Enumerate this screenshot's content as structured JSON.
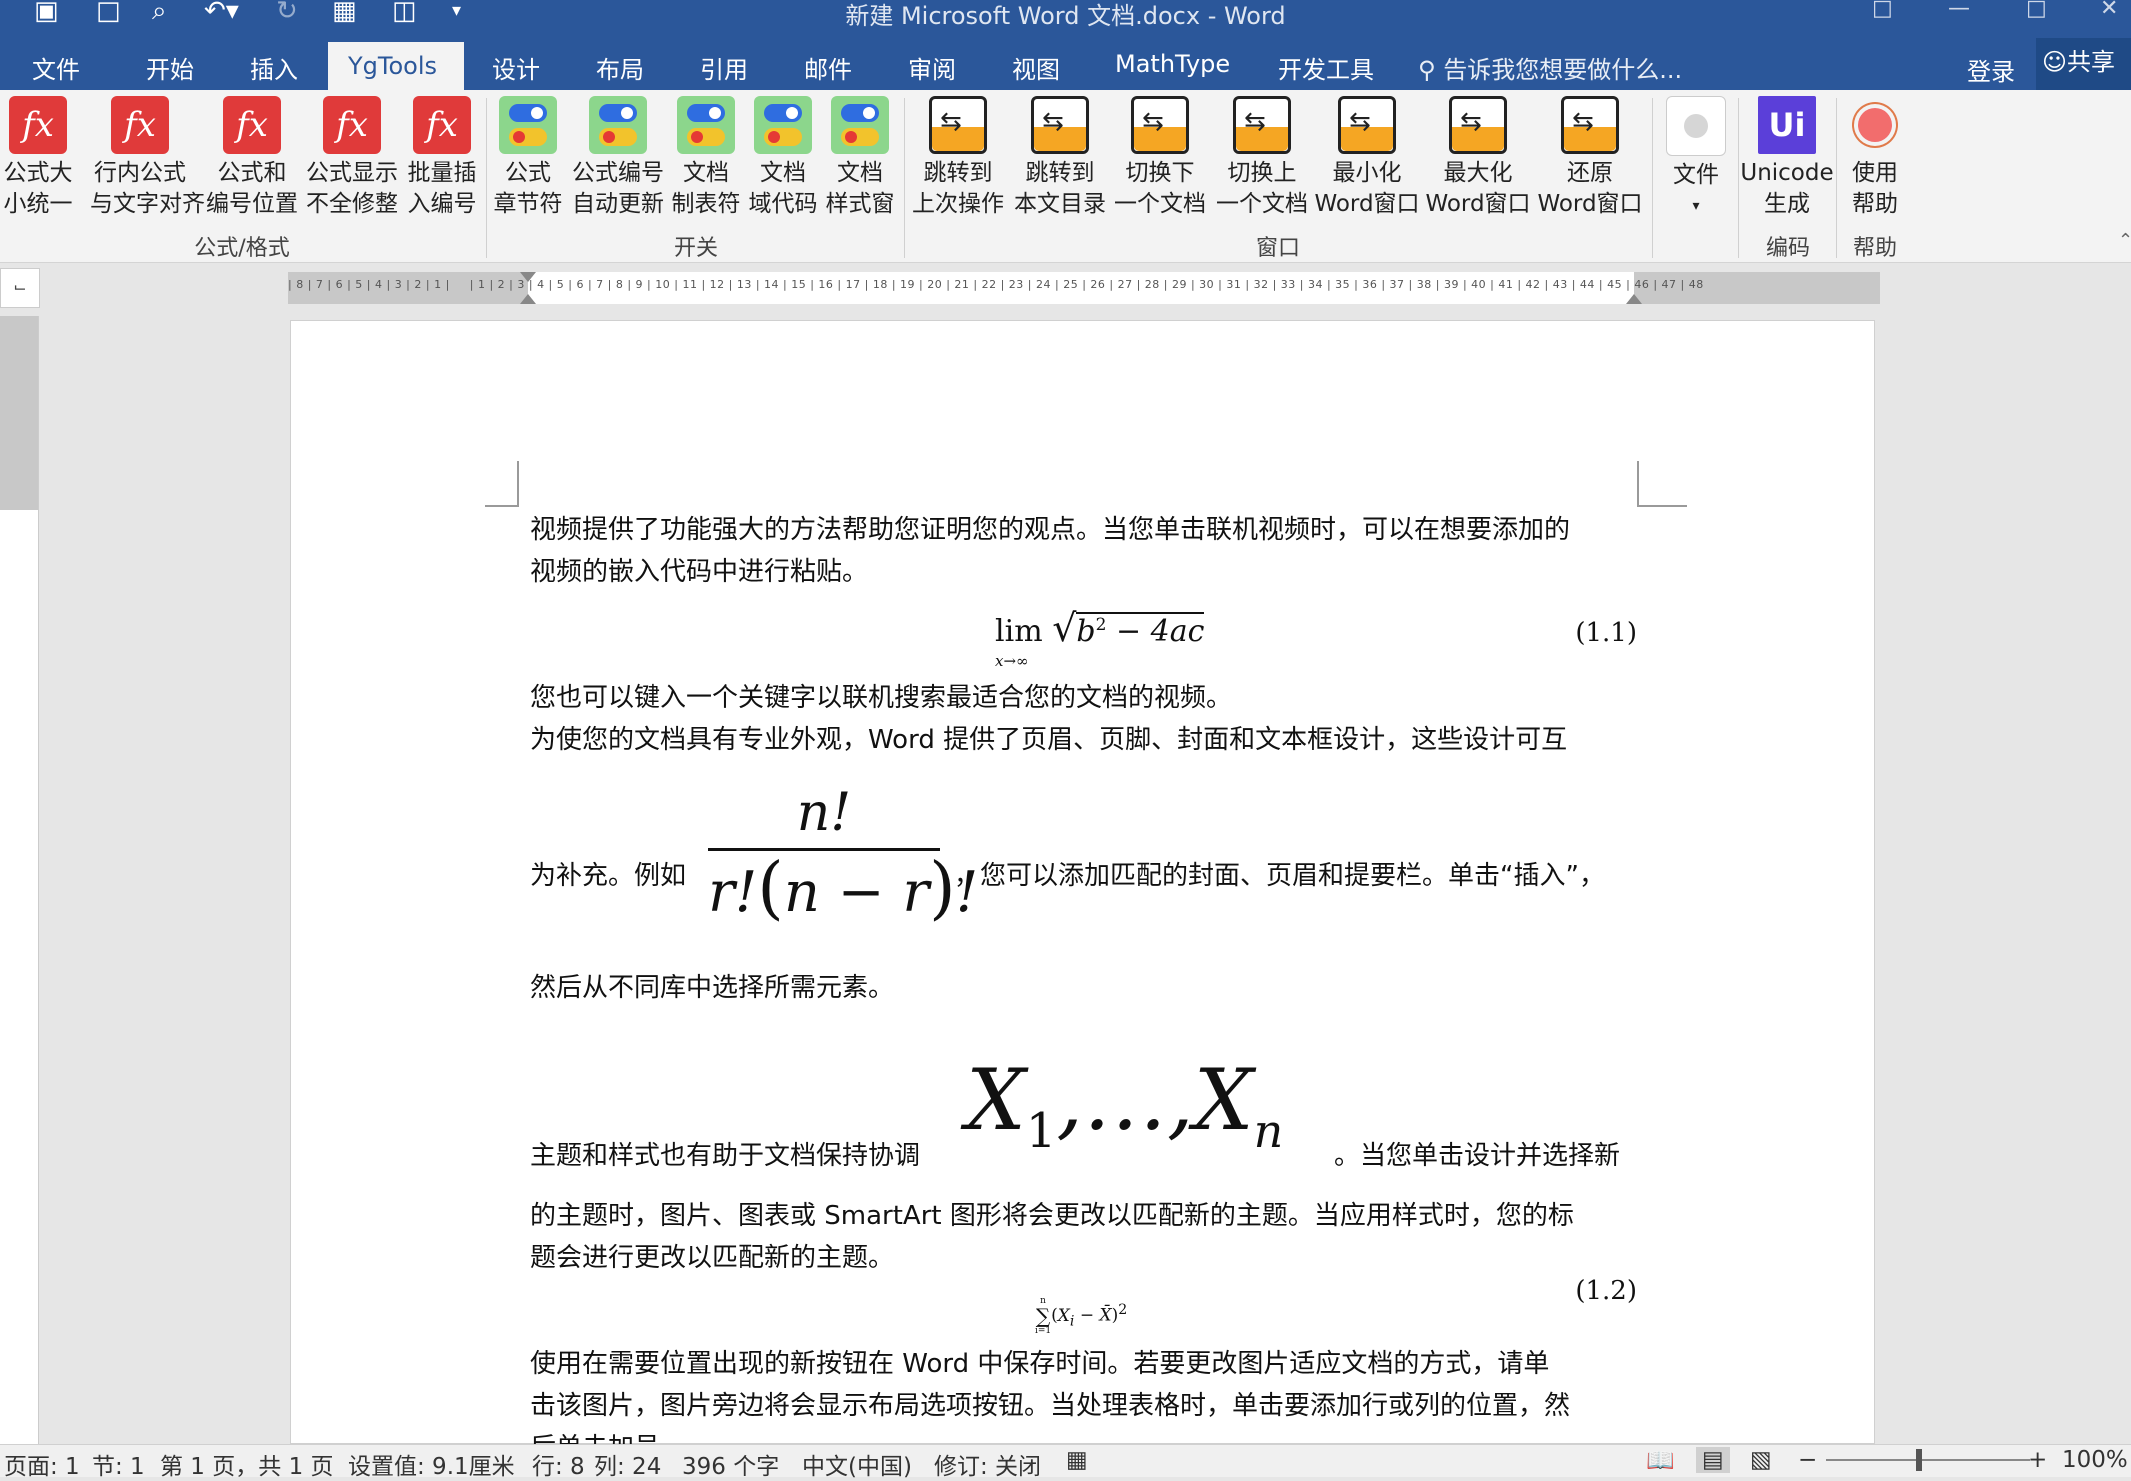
{
  "window": {
    "title": "新建 Microsoft Word 文档.docx - Word"
  },
  "tabs": [
    "文件",
    "开始",
    "插入",
    "YgTools",
    "设计",
    "布局",
    "引用",
    "邮件",
    "审阅",
    "视图",
    "MathType",
    "开发工具"
  ],
  "active_tab": "YgTools",
  "tell_me": "告诉我您想要做什么...",
  "login": "登录",
  "share": "共享",
  "ribbon": {
    "formula_buttons": [
      {
        "l1": "公式大",
        "l2": "小统一"
      },
      {
        "l1": "行内公式",
        "l2": "与文字对齐"
      },
      {
        "l1": "公式和",
        "l2": "编号位置"
      },
      {
        "l1": "公式显示",
        "l2": "不全修整"
      },
      {
        "l1": "批量插",
        "l2": "入编号"
      }
    ],
    "switch_buttons": [
      {
        "l1": "公式",
        "l2": "章节符"
      },
      {
        "l1": "公式编号",
        "l2": "自动更新"
      },
      {
        "l1": "文档",
        "l2": "制表符"
      },
      {
        "l1": "文档",
        "l2": "域代码"
      },
      {
        "l1": "文档",
        "l2": "样式窗"
      }
    ],
    "window_buttons": [
      {
        "l1": "跳转到",
        "l2": "上次操作"
      },
      {
        "l1": "跳转到",
        "l2": "本文目录"
      },
      {
        "l1": "切换下",
        "l2": "一个文档"
      },
      {
        "l1": "切换上",
        "l2": "一个文档"
      },
      {
        "l1": "最小化",
        "l2": "Word窗口"
      },
      {
        "l1": "最大化",
        "l2": "Word窗口"
      },
      {
        "l1": "还原",
        "l2": "Word窗口"
      }
    ],
    "file_button": "文件",
    "unicode_button": {
      "l1": "Unicode",
      "l2": "生成"
    },
    "help_button": {
      "l1": "使用",
      "l2": "帮助"
    },
    "groups": {
      "formula": "公式/格式",
      "switch": "开关",
      "window": "窗口",
      "encode": "编码",
      "help": "帮助"
    }
  },
  "document": {
    "p1": "视频提供了功能强大的方法帮助您证明您的观点。当您单击联机视频时，可以在想要添加的",
    "p1b": "视频的嵌入代码中进行粘贴。",
    "eq1_number": "(1.1)",
    "p2": "您也可以键入一个关键字以联机搜索最适合您的文档的视频。",
    "p3": "为使您的文档具有专业外观，Word 提供了页眉、页脚、封面和文本框设计，这些设计可互",
    "p3b_pre": "为补充。例如",
    "p3b_post": "，您可以添加匹配的封面、页眉和提要栏。单击“插入”，",
    "p3c": "然后从不同库中选择所需元素。",
    "p4_pre": "主题和样式也有助于文档保持协调",
    "p4_post": "。当您单击设计并选择新",
    "p4b": "的主题时，图片、图表或 SmartArt 图形将会更改以匹配新的主题。当应用样式时，您的标",
    "p4c": "题会进行更改以匹配新的主题。",
    "eq2_number": "(1.2)",
    "p5": "使用在需要位置出现的新按钮在 Word 中保存时间。若要更改图片适应文档的方式，请单",
    "p5b": "击该图片，图片旁边将会显示布局选项按钮。当处理表格时，单击要添加行或列的位置，然",
    "p5c": "后单击加号。"
  },
  "status": {
    "page": "页面: 1",
    "section": "节: 1",
    "page_of": "第 1 页，共 1 页",
    "setting": "设置值: 9.1厘米",
    "line": "行: 8",
    "col": "列: 24",
    "words": "396 个字",
    "lang": "中文(中国)",
    "track": "修订: 关闭",
    "zoom": "100%"
  }
}
